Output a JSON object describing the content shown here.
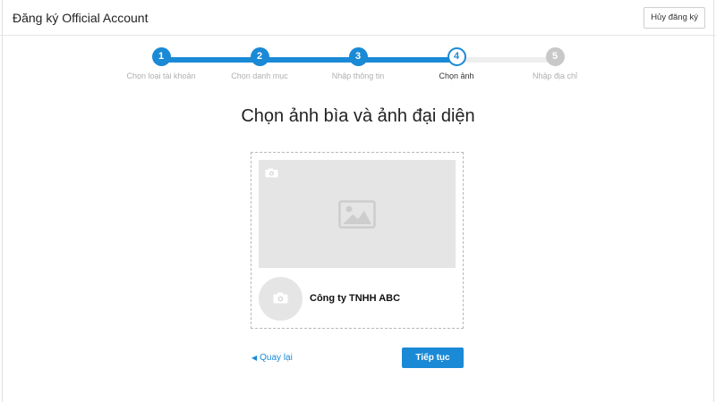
{
  "header": {
    "title": "Đăng ký Official Account",
    "cancel_label": "Hủy đăng ký"
  },
  "stepper": {
    "current_step": 4,
    "steps": [
      {
        "number": "1",
        "label": "Chọn loại tài khoản",
        "state": "done"
      },
      {
        "number": "2",
        "label": "Chọn danh mục",
        "state": "done"
      },
      {
        "number": "3",
        "label": "Nhập thông tin",
        "state": "done"
      },
      {
        "number": "4",
        "label": "Chọn ảnh",
        "state": "current"
      },
      {
        "number": "5",
        "label": "Nhập địa chỉ",
        "state": "future"
      }
    ]
  },
  "main": {
    "title": "Chọn ảnh bìa và ảnh đại diện",
    "company_name": "Công ty TNHH ABC"
  },
  "actions": {
    "back_label": "Quay lại",
    "next_label": "Tiếp tục"
  },
  "icons": {
    "cover_camera": "camera-icon",
    "cover_placeholder": "image-placeholder-icon",
    "avatar_camera": "camera-icon",
    "back_arrow": "chevron-left-icon"
  },
  "colors": {
    "accent": "#1a8ad6",
    "placeholder_bg": "#e5e5e5",
    "inactive_step": "#c8c8c8"
  }
}
